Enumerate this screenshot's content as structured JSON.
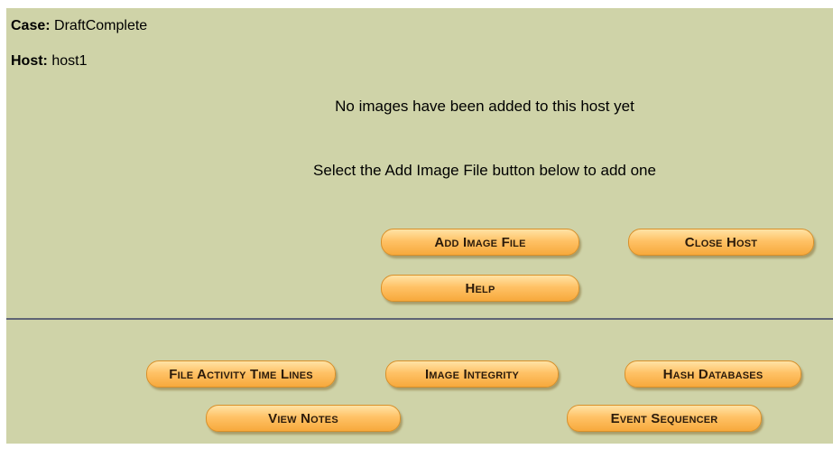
{
  "case": {
    "label": "Case:",
    "value": "DraftComplete"
  },
  "host": {
    "label": "Host:",
    "value": "host1"
  },
  "messages": {
    "no_images": "No images have been added to this host yet",
    "instruction": "Select the Add Image File button below to add one"
  },
  "host_buttons": {
    "add_image_file": "Add Image File",
    "close_host": "Close Host",
    "help": "Help"
  },
  "tool_buttons": {
    "file_activity_time_lines": "File Activity Time Lines",
    "image_integrity": "Image Integrity",
    "hash_databases": "Hash Databases",
    "view_notes": "View Notes",
    "event_sequencer": "Event Sequencer"
  },
  "colors": {
    "panel_background": "#cfd3a8",
    "button_fill": "#ffc266",
    "divider": "#5f6474"
  }
}
